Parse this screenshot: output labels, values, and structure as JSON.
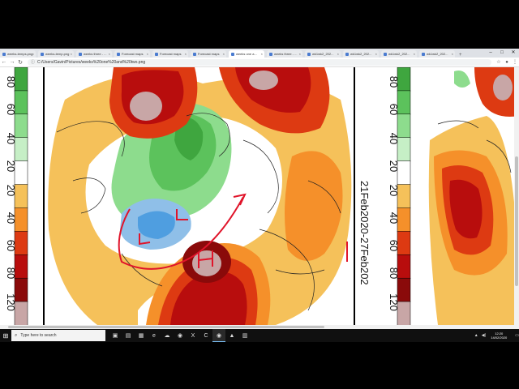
{
  "browser": {
    "tabs": [
      {
        "label": "weeks-temps.png",
        "active": false
      },
      {
        "label": "weeks-temp.png",
        "active": false
      },
      {
        "label": "weeks three - ...",
        "active": false
      },
      {
        "label": "Forecast maps",
        "active": false
      },
      {
        "label": "Forecast maps",
        "active": false
      },
      {
        "label": "Forecast maps",
        "active": false
      },
      {
        "label": "weeks one a...",
        "active": true
      },
      {
        "label": "weeks three - ...",
        "active": false
      },
      {
        "label": "wk1wk2_202...",
        "active": false
      },
      {
        "label": "wk1wk2_202...",
        "active": false
      },
      {
        "label": "wk1wk2_202...",
        "active": false
      },
      {
        "label": "wk1wk2_202...",
        "active": false
      }
    ],
    "new_tab": "+",
    "window_controls": {
      "minimize": "–",
      "maximize": "□",
      "close": "✕"
    },
    "nav": {
      "back": "←",
      "forward": "→",
      "reload": "↻"
    },
    "address": "C:/Users/Gavin/Pictures/weeks%20one%20and%20two.png",
    "address_icon": "file-icon",
    "toolbar_icons": [
      "star-icon",
      "profile-icon",
      "menu-icon"
    ]
  },
  "map_left": {
    "scale_labels": [
      "80",
      "60",
      "40",
      "20",
      "20",
      "40",
      "60",
      "80",
      "120"
    ],
    "scale_colors": [
      "#3fa63f",
      "#5cc25c",
      "#8ddc8d",
      "#c6efc6",
      "#ffffff",
      "#f5c15a",
      "#f5902a",
      "#dd3a12",
      "#b80d0d",
      "#8a0a0a",
      "#c8a6a6"
    ],
    "date_label": "21Feb2020-27Feb202"
  },
  "map_right": {
    "scale_labels": [
      "80",
      "60",
      "40",
      "20",
      "20",
      "40",
      "60",
      "80",
      "120"
    ]
  },
  "taskbar": {
    "search_placeholder": "Type here to search",
    "apps": [
      "task-view",
      "file-explorer",
      "store",
      "edge",
      "onedrive",
      "chrome-1",
      "excel",
      "camtasia",
      "chrome-2",
      "green-app",
      "notes"
    ],
    "time": "12:20",
    "date": "14/02/2020"
  }
}
